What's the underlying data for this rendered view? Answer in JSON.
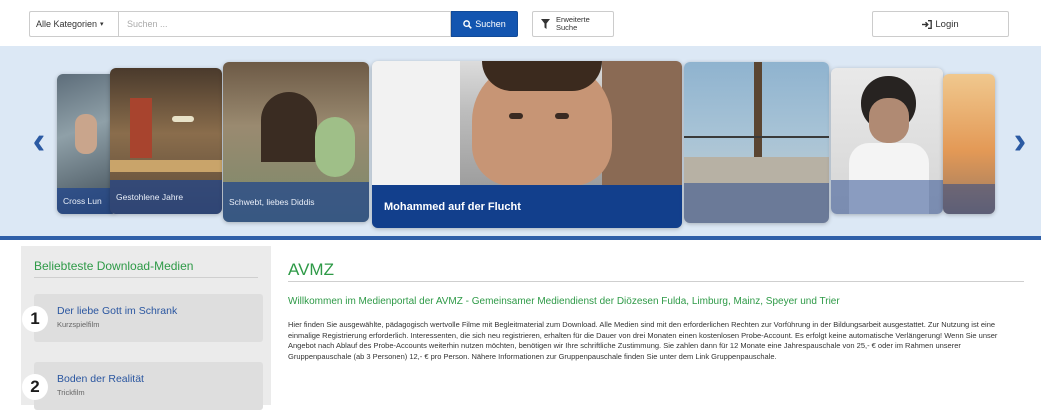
{
  "topbar": {
    "category_label": "Alle Kategorien",
    "search_placeholder": "Suchen ...",
    "search_button": "Suchen",
    "advanced_label": "Erweiterte\nSuche",
    "login_label": "Login"
  },
  "carousel": {
    "items": [
      {
        "caption": "Cross Lun"
      },
      {
        "caption": "Gestohlene Jahre"
      },
      {
        "caption": "Schwebt, liebes Diddis"
      },
      {
        "caption": "Mohammed auf der Flucht"
      },
      {
        "caption": ""
      },
      {
        "caption": ""
      },
      {
        "caption": ""
      }
    ]
  },
  "sidebar": {
    "title": "Beliebteste Download-Medien",
    "items": [
      {
        "rank": "1",
        "title": "Der liebe Gott im Schrank",
        "type": "Kurzspielfilm"
      },
      {
        "rank": "2",
        "title": "Boden der Realität",
        "type": "Trickfilm"
      }
    ]
  },
  "main": {
    "title": "AVMZ",
    "subtitle": "Willkommen im Medienportal der AVMZ - Gemeinsamer Mediendienst der Diözesen Fulda, Limburg, Mainz, Speyer und Trier",
    "body": "Hier finden Sie ausgewählte, pädagogisch wertvolle Filme mit Begleitmaterial zum Download. Alle Medien sind mit den erforderlichen Rechten zur Vorführung in der Bildungsarbeit ausgestattet. Zur Nutzung ist eine einmalige Registrierung erforderlich. Interessenten, die sich neu registrieren, erhalten für die Dauer von drei Monaten einen kostenlosen Probe-Account. Es erfolgt keine automatische Verlängerung! Wenn Sie unser Angebot nach Ablauf des Probe-Accounts weiterhin nutzen möchten, benötigen wir Ihre schriftliche Zustimmung. Sie zahlen dann für 12 Monate eine Jahrespauschale von 25,- € oder im Rahmen unserer Gruppenpauschale (ab 3 Personen) 12,- € pro Person. Nähere Informationen zur Gruppenpauschale finden Sie unter dem Link Gruppenpauschale."
  },
  "colors": {
    "brand_blue": "#1355b0",
    "accent_green": "#2e9a47",
    "carousel_bg": "#dce8f5"
  }
}
